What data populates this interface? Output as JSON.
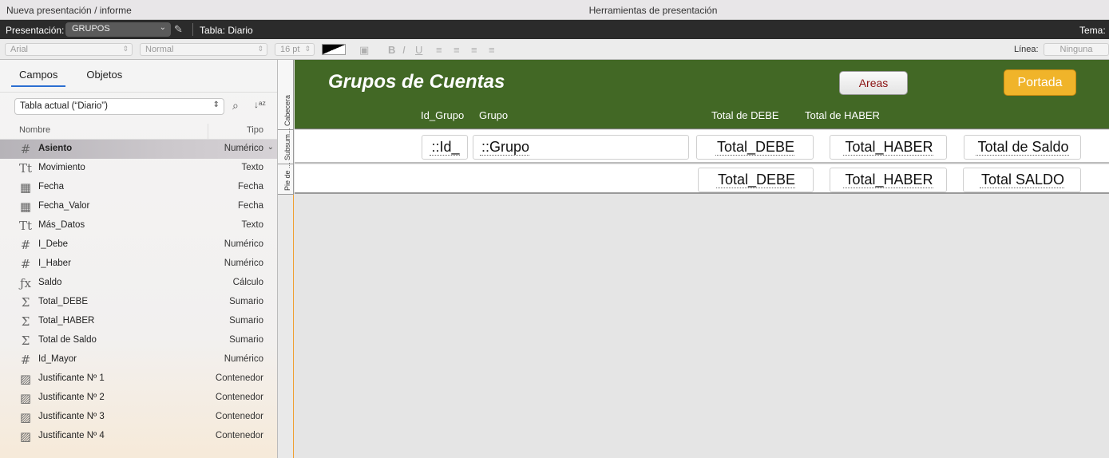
{
  "titlebar": {
    "left": "Nueva presentación / informe",
    "center": "Herramientas de presentación"
  },
  "layoutbar": {
    "presentacion_label": "Presentación:",
    "presentacion_value": "GRUPOS",
    "tabla": "Tabla: Diario",
    "tema": "Tema: I"
  },
  "formatbar": {
    "font": "Arial",
    "style": "Normal",
    "size": "16 pt",
    "linea_label": "Línea:",
    "linea_value": "Ninguna"
  },
  "leftpane": {
    "tabs": [
      "Campos",
      "Objetos"
    ],
    "table_select": "Tabla actual (“Diario”)",
    "col_nombre": "Nombre",
    "col_tipo": "Tipo",
    "fields": [
      {
        "icon": "#",
        "name": "Asiento",
        "type": "Numérico"
      },
      {
        "icon": "Tt",
        "name": "Movimiento",
        "type": "Texto"
      },
      {
        "icon": "cal",
        "name": "Fecha",
        "type": "Fecha"
      },
      {
        "icon": "cal",
        "name": "Fecha_Valor",
        "type": "Fecha"
      },
      {
        "icon": "Tt",
        "name": "Más_Datos",
        "type": "Texto"
      },
      {
        "icon": "#",
        "name": "I_Debe",
        "type": "Numérico"
      },
      {
        "icon": "#",
        "name": "I_Haber",
        "type": "Numérico"
      },
      {
        "icon": "fx",
        "name": "Saldo",
        "type": "Cálculo"
      },
      {
        "icon": "sum",
        "name": "Total_DEBE",
        "type": "Sumario"
      },
      {
        "icon": "sum",
        "name": "Total_HABER",
        "type": "Sumario"
      },
      {
        "icon": "sum",
        "name": "Total de Saldo",
        "type": "Sumario"
      },
      {
        "icon": "#",
        "name": "Id_Mayor",
        "type": "Numérico"
      },
      {
        "icon": "img",
        "name": "Justificante Nº 1",
        "type": "Contenedor"
      },
      {
        "icon": "img",
        "name": "Justificante Nº 2",
        "type": "Contenedor"
      },
      {
        "icon": "img",
        "name": "Justificante Nº 3",
        "type": "Contenedor"
      },
      {
        "icon": "img",
        "name": "Justificante Nº 4",
        "type": "Contenedor"
      }
    ]
  },
  "parts": {
    "cabecera": "Cabecera",
    "subsumario": "Subsum...",
    "pie": "Pie de ..."
  },
  "layout": {
    "title": "Grupos de Cuentas",
    "areas_button": "Areas",
    "portada_button": "Portada",
    "col_id_grupo": "Id_Grupo",
    "col_grupo": "Grupo",
    "col_total_debe": "Total de DEBE",
    "col_total_haber": "Total de HABER",
    "sub_id": "::Id_",
    "sub_grupo": "::Grupo",
    "sub_total_debe": "Total_DEBE",
    "sub_total_haber": "Total_HABER",
    "sub_total_saldo": "Total de Saldo",
    "foot_total_debe": "Total_DEBE",
    "foot_total_haber": "Total_HABER",
    "foot_total_saldo": "Total SALDO"
  },
  "colors": {
    "header_green": "#426825",
    "portada_orange": "#f0b42a",
    "selection_blue": "#2b6fd1"
  }
}
